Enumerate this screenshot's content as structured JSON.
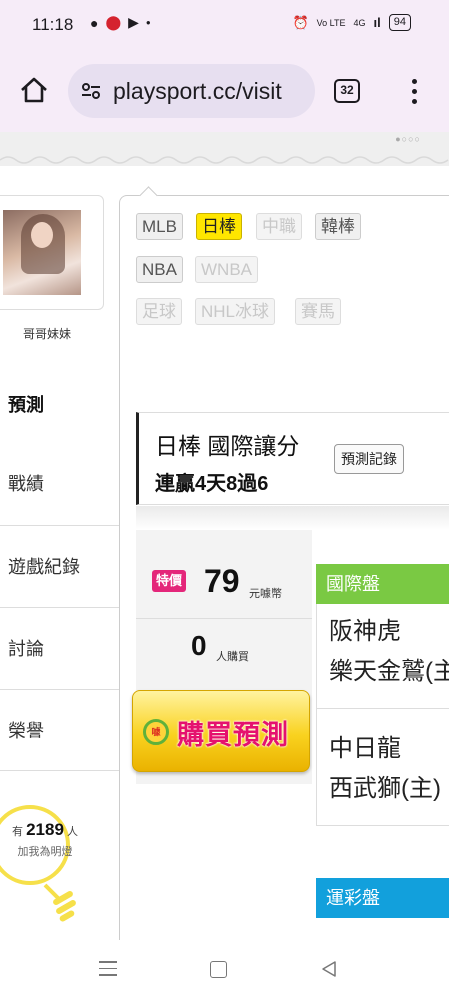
{
  "status_bar": {
    "time": "11:18",
    "network": "4G",
    "battery": "94"
  },
  "browser": {
    "url": "playsport.cc/visit",
    "tab_count": "32"
  },
  "profile": {
    "name": "哥哥妹妹"
  },
  "sidebar": {
    "title": "預測",
    "items": [
      {
        "label": "戰績"
      },
      {
        "label": "遊戲紀錄"
      },
      {
        "label": "討論"
      },
      {
        "label": "榮譽"
      }
    ],
    "follow": {
      "prefix": "有",
      "count": "2189",
      "suffix": "人",
      "note": "加我為明燈"
    }
  },
  "sport_tags": [
    {
      "label": "MLB",
      "state": "normal"
    },
    {
      "label": "日棒",
      "state": "active"
    },
    {
      "label": "中職",
      "state": "disabled"
    },
    {
      "label": "韓棒",
      "state": "normal"
    },
    {
      "label": "NBA",
      "state": "normal"
    },
    {
      "label": "WNBA",
      "state": "disabled"
    },
    {
      "label": "足球",
      "state": "disabled"
    },
    {
      "label": "NHL冰球",
      "state": "disabled"
    },
    {
      "label": "賽馬",
      "state": "disabled"
    }
  ],
  "prediction": {
    "title": "日棒 國際讓分",
    "streak": "連贏4天8過6",
    "record_button": "預測記錄"
  },
  "pricing": {
    "badge": "特價",
    "price": "79",
    "price_unit": "元噱幣",
    "buyers": "0",
    "buyers_unit": "人購買",
    "buy_button": "購買預測",
    "coin_text": "噱"
  },
  "odds": {
    "intl_header": "國際盤",
    "sports_header": "運彩盤",
    "games": [
      {
        "team1": "阪神虎",
        "team2": "樂天金鷲(主)"
      },
      {
        "team1": "中日龍",
        "team2": "西武獅(主)"
      }
    ]
  },
  "colors": {
    "browser_bg": "#f6ecf8",
    "intl_header": "#7ac943",
    "sports_header": "#12a0dc",
    "special_badge": "#e4267a",
    "active_tag": "#ffe600"
  }
}
